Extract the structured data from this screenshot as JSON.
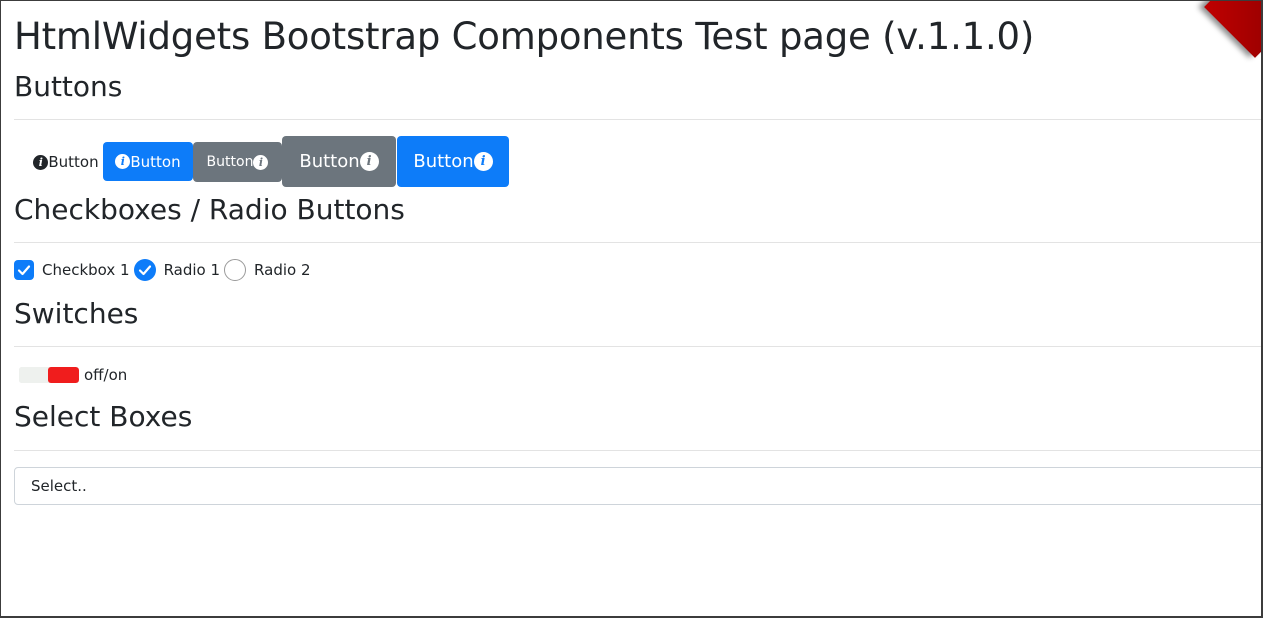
{
  "page": {
    "title": "HtmlWidgets Bootstrap Components Test page (v.1.1.0)"
  },
  "sections": {
    "buttons": {
      "title": "Buttons"
    },
    "checkboxes": {
      "title": "Checkboxes / Radio Buttons"
    },
    "switches": {
      "title": "Switches"
    },
    "selects": {
      "title": "Select Boxes"
    }
  },
  "buttons": [
    {
      "label": "Button",
      "style": "link",
      "icon": "info-icon"
    },
    {
      "label": "Button",
      "style": "primary",
      "icon": "info-icon"
    },
    {
      "label": "Button",
      "style": "secondary",
      "icon": "info-icon"
    },
    {
      "label": "Button",
      "style": "secondary-large",
      "icon": "info-icon"
    },
    {
      "label": "Button",
      "style": "primary-large",
      "icon": "info-icon"
    }
  ],
  "checks": [
    {
      "type": "checkbox",
      "label": "Checkbox 1",
      "checked": true
    },
    {
      "type": "radio",
      "label": "Radio 1",
      "checked": true
    },
    {
      "type": "radio",
      "label": "Radio 2",
      "checked": false
    }
  ],
  "switch": {
    "label": "off/on",
    "state": "on",
    "on_color": "#f01d1d"
  },
  "select": {
    "value": "Select.."
  },
  "colors": {
    "primary": "#0d7cf9",
    "secondary": "#6c757d",
    "corner": "#a00000"
  }
}
